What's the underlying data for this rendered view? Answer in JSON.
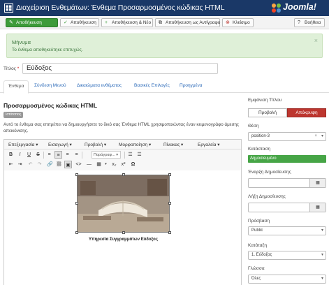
{
  "header": {
    "title": "Διαχείριση Ενθεμάτων: Ένθεμα Προσαρμοσμένος κώδικας HTML",
    "logo_text": "Joomla!",
    "bar_color": "#1a3867"
  },
  "toolbar": {
    "save": "Αποθήκευση",
    "save_icon": "edit-icon",
    "save_close": "Αποθήκευση",
    "save_close_icon": "check-icon",
    "save_new": "Αποθήκευση & Νέο",
    "save_new_icon": "plus-icon",
    "save_copy": "Αποθήκευση ως Αντίγραφο",
    "save_copy_icon": "copy-icon",
    "close": "Κλείσιμο",
    "close_icon": "cancel-icon",
    "help": "Βοήθεια",
    "help_icon": "question-icon"
  },
  "alert": {
    "heading": "Μήνυμα",
    "message": "Το ένθεμα αποθηκεύτηκε επιτυχώς.",
    "close": "×"
  },
  "form": {
    "title_label": "Τίτλος",
    "required_mark": "*",
    "title_value": "Εύδοξος"
  },
  "tabs": [
    {
      "label": "Ένθεμα",
      "active": true
    },
    {
      "label": "Σύνδεση Μενού",
      "active": false
    },
    {
      "label": "Δικαιώματα ενθέματος",
      "active": false
    },
    {
      "label": "Βασικές Επιλογές",
      "active": false
    },
    {
      "label": "Προηγμένα",
      "active": false
    }
  ],
  "module": {
    "heading": "Προσαρμοσμένος κώδικας HTML",
    "badge": "Ιστότοπος",
    "description": "Αυτό το ένθεμα σας επιτρέπει να δημιουργήσετε το δικό σας Ένθεμα HTML χρησιμοποιώντας έναν κειμενογράφο άμεσης απεικόνισης."
  },
  "editor": {
    "menus": [
      "Επεξεργασία",
      "Εισαγωγή",
      "Προβολή",
      "Μορφοποίηση",
      "Πίνακας",
      "Εργαλεία"
    ],
    "format_dropdown": "Παράγραφ...",
    "caption": "Υπηρεσία Συγγραμμάτων Εύδοξος",
    "icons": {
      "bold": "B",
      "italic": "I",
      "underline": "U",
      "strike": "S",
      "align_left": "≡",
      "align_center": "≡",
      "align_right": "≡",
      "justify": "≡",
      "bullets": "☰",
      "numbers": "☰",
      "outdent": "⇤",
      "indent": "⇥",
      "undo": "↶",
      "redo": "↷",
      "link": "🔗",
      "unlink": "⛓",
      "image": "▣",
      "code": "<>",
      "hr": "—",
      "table": "▦",
      "subscript": "x₂",
      "superscript": "x²",
      "omega": "Ω"
    }
  },
  "sidebar": {
    "show_title_label": "Εμφάνιση Τίτλου",
    "show": "Προβολή",
    "hide": "Απόκρυψη",
    "position_label": "Θέση",
    "position_value": "position-3",
    "status_label": "Κατάσταση",
    "status_value": "Δημοσιευμένο",
    "publish_up_label": "Έναρξη Δημοσίευσης",
    "publish_down_label": "Λήξη Δημοσίευσης",
    "access_label": "Πρόσβαση",
    "access_value": "Public",
    "ordering_label": "Κατάταξη",
    "ordering_value": "1. Εύδοξος",
    "language_label": "Γλώσσα",
    "language_value": "Όλες",
    "hide_color": "#bd362f",
    "published_color": "#46a546"
  }
}
